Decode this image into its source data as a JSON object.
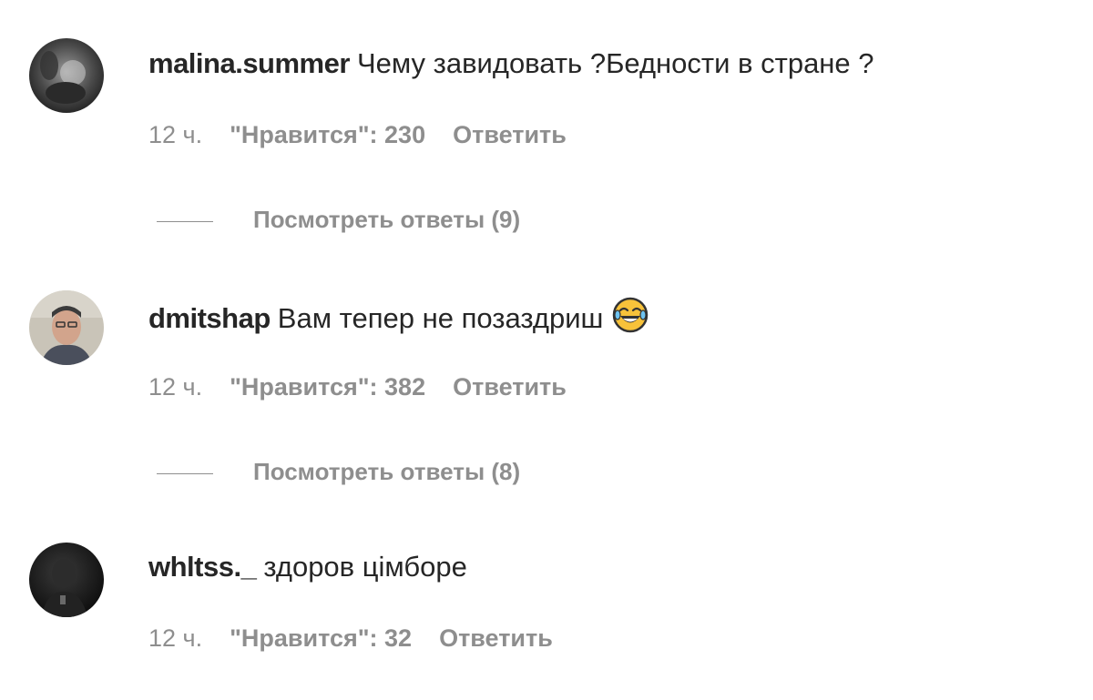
{
  "comments": [
    {
      "username": "malina.summer",
      "text": "Чему завидовать ?Бедности в стране ?",
      "time": "12 ч.",
      "likes": "\"Нравится\": 230",
      "reply": "Ответить",
      "view_replies": "Посмотреть ответы (9)",
      "avatar_icon": "avatar-photo"
    },
    {
      "username": "dmitshap",
      "text": "Вам тепер не позаздриш",
      "emoji": "face-with-tears-of-joy-icon",
      "time": "12 ч.",
      "likes": "\"Нравится\": 382",
      "reply": "Ответить",
      "view_replies": "Посмотреть ответы (8)",
      "avatar_icon": "avatar-photo"
    },
    {
      "username": "whltss._",
      "text": "здоров цімборе",
      "time": "12 ч.",
      "likes": "\"Нравится\": 32",
      "reply": "Ответить",
      "avatar_icon": "avatar-photo"
    }
  ],
  "colors": {
    "text": "#262626",
    "secondary": "#8e8e8e",
    "background": "#ffffff"
  }
}
